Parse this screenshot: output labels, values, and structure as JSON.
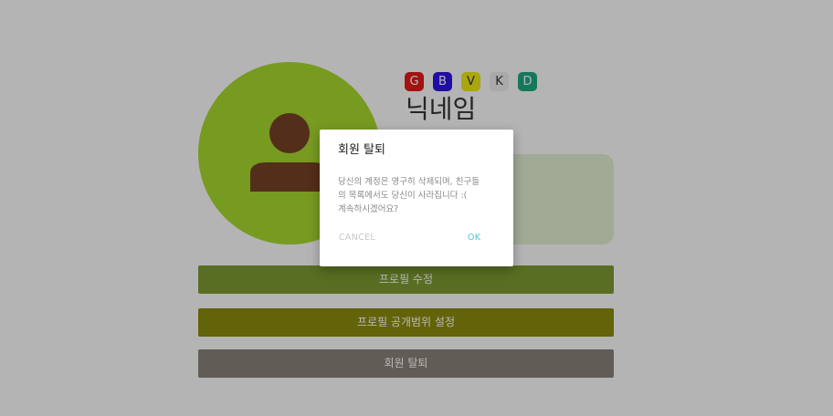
{
  "profile": {
    "badges": [
      {
        "letter": "G",
        "color": "#e11a1a"
      },
      {
        "letter": "B",
        "color": "#2a14e0"
      },
      {
        "letter": "V",
        "color": "#ebe61a"
      },
      {
        "letter": "K",
        "color": "#eaeaea"
      },
      {
        "letter": "D",
        "color": "#1fa77f"
      }
    ],
    "nickname": "닉네임",
    "avatar_icon": "person-icon"
  },
  "actions": {
    "edit_profile": "프로필 수정",
    "privacy_settings": "프로필 공개범위 설정",
    "withdraw": "회원 탈퇴"
  },
  "dialog": {
    "title": "회원 탈퇴",
    "message": "당신의 계정은 영구히 삭제되며, 친구들\n의 목록에서도 당신이 사라집니다 :(\n계속하시겠어요?",
    "cancel_label": "CANCEL",
    "ok_label": "OK"
  },
  "colors": {
    "avatar_bg": "#a6d62f",
    "person": "#744024",
    "edit_button": "#7c9930",
    "privacy_button": "#8a8a0d",
    "withdraw_button": "#878078",
    "ok_accent": "#4fc3d6"
  }
}
